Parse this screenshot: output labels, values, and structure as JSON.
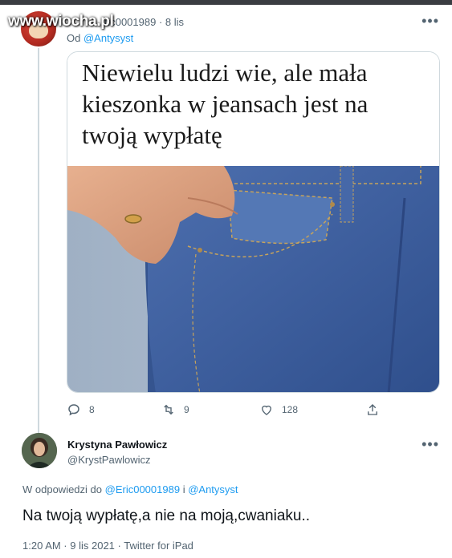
{
  "watermark": "www.wiocha.pl",
  "tweet1": {
    "handle_partial": "ric0001989",
    "separator": "·",
    "date": "8 lis",
    "reply_prefix": "Od",
    "reply_to": "@Antysyst",
    "more_icon": "more-dots-icon",
    "image_caption_line1": "Niewielu ludzi wie, ale mała",
    "image_caption_line2": "kieszonka w jeansach jest na",
    "image_caption_line3": "twoją wypłatę",
    "actions": {
      "reply_count": "8",
      "retweet_count": "9",
      "like_count": "128"
    }
  },
  "tweet2": {
    "name": "Krystyna Pawłowicz",
    "handle": "@KrystPawlowicz",
    "replying_prefix": "W odpowiedzi do",
    "replying_user1": "@Eric00001989",
    "replying_joiner": "i",
    "replying_user2": "@Antysyst",
    "text": "Na twoją wypłatę,a nie na moją,cwaniaku..",
    "footer": "1:20 AM · 9 lis 2021 · Twitter for iPad"
  },
  "colors": {
    "link": "#1d9bf0",
    "secondary_text": "#536471",
    "primary_text": "#0f1419",
    "denim": "#3f5f9c"
  }
}
